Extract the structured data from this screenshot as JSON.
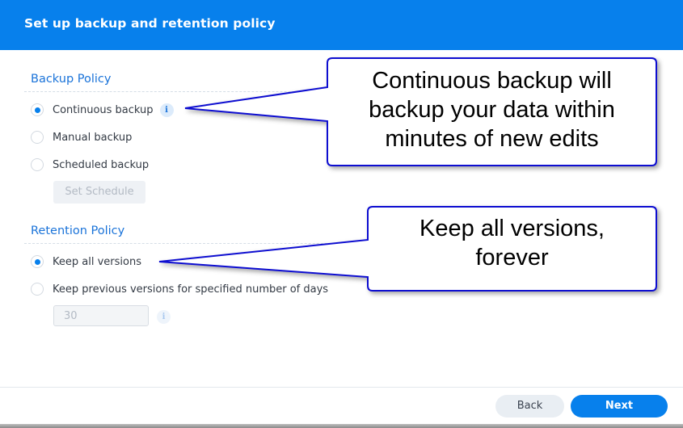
{
  "header": {
    "title": "Set up backup and retention policy"
  },
  "backup_policy": {
    "title": "Backup Policy",
    "options": [
      {
        "label": "Continuous backup",
        "checked": true,
        "has_info": true
      },
      {
        "label": "Manual backup",
        "checked": false
      },
      {
        "label": "Scheduled backup",
        "checked": false
      }
    ],
    "set_schedule_label": "Set Schedule"
  },
  "retention_policy": {
    "title": "Retention Policy",
    "options": [
      {
        "label": "Keep all versions",
        "checked": true
      },
      {
        "label": "Keep previous versions for specified number of days",
        "checked": false
      }
    ],
    "days_value": "30"
  },
  "footer": {
    "back_label": "Back",
    "next_label": "Next"
  },
  "annotations": {
    "callout1_lines": [
      "Continuous backup will",
      "backup your data within",
      "minutes of new edits"
    ],
    "callout2_lines": [
      "Keep all versions,",
      "forever"
    ]
  },
  "colors": {
    "accent": "#0780ec",
    "callout_border": "#1010d0"
  }
}
